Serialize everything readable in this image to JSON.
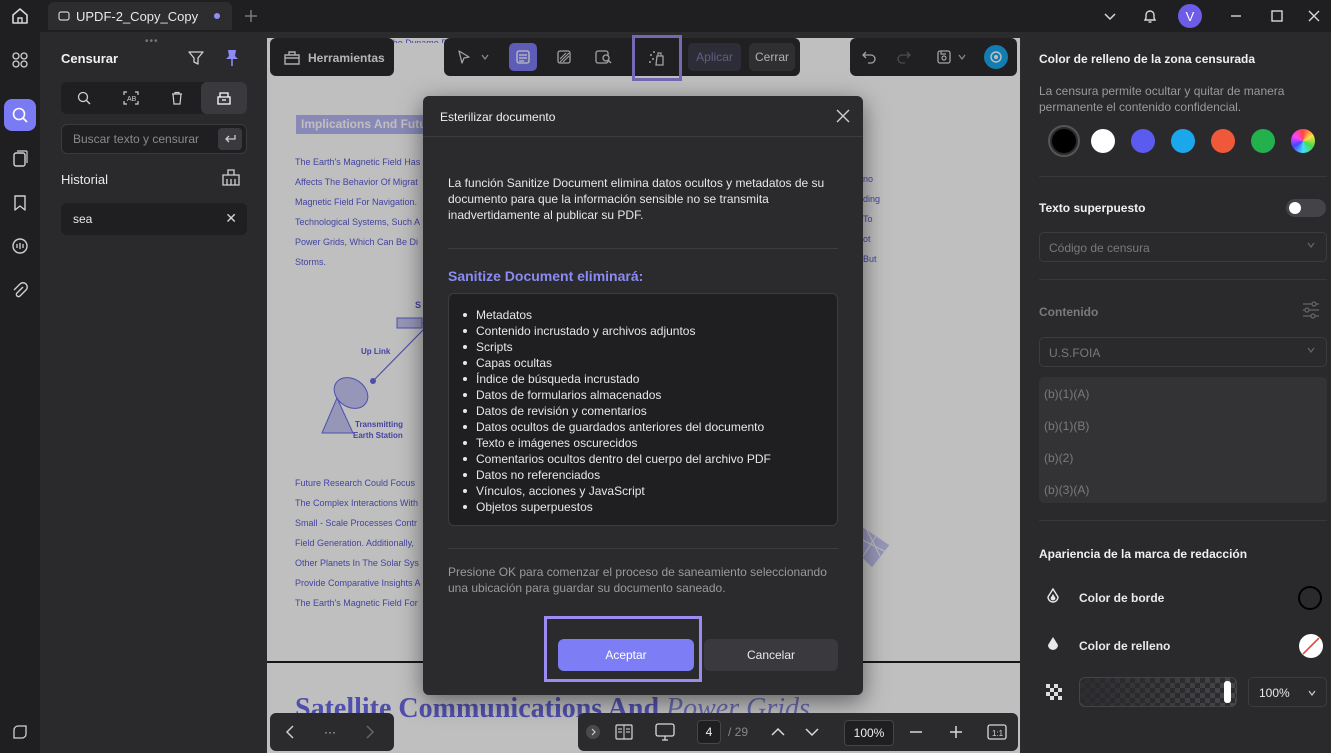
{
  "titlebar": {
    "tab_title": "UPDF-2_Copy_Copy",
    "avatar_letter": "V",
    "accent": "#7d7df6"
  },
  "left_panel": {
    "title": "Censurar",
    "search_placeholder": "Buscar texto y censurar",
    "history_label": "Historial",
    "history_items": [
      "sea"
    ]
  },
  "toolbar": {
    "tools_label": "Herramientas",
    "apply_label": "Aplicar",
    "close_label": "Cerrar"
  },
  "document": {
    "heading": "Implications And Futu",
    "top_cut": "Compared To The Dynamo Process.",
    "lines_left": [
      "The Earth's Magnetic Field Has",
      "Affects The Behavior Of Migrat",
      "Magnetic Field For Navigation.",
      "Technological Systems, Such A",
      "Power Grids, Which Can Be Di",
      "Storms."
    ],
    "lines_right": [
      "no",
      "ding",
      "To",
      "ot",
      "But"
    ],
    "diagram_labels": [
      "S",
      "Up Link",
      "Transmitting",
      "Earth Station"
    ],
    "lines_lower": [
      "Future Research Could Focus",
      "The Complex Interactions With",
      "Small - Scale Processes Contr",
      "Field Generation. Additionally,",
      "Other Planets In The Solar Sys",
      "Provide Comparative Insights A",
      "The Earth's Magnetic Field For"
    ],
    "big_title": "Satellite Communications And",
    "big_title_italic": "Power Grids"
  },
  "dialog": {
    "title": "Esterilizar documento",
    "intro": "La función Sanitize Document elimina datos ocultos y metadatos de su documento para que la información sensible no se transmita inadvertidamente al publicar su PDF.",
    "subtitle": "Sanitize Document eliminará:",
    "items": [
      "Metadatos",
      "Contenido incrustado y archivos adjuntos",
      "Scripts",
      "Capas ocultas",
      "Índice de búsqueda incrustado",
      "Datos de formularios almacenados",
      "Datos de revisión y comentarios",
      "Datos ocultos de guardados anteriores del documento",
      "Texto e imágenes oscurecidos",
      "Comentarios ocultos dentro del cuerpo del archivo PDF",
      "Datos no referenciados",
      "Vínculos, acciones y JavaScript",
      "Objetos superpuestos"
    ],
    "note": "Presione OK para comenzar el proceso de saneamiento seleccionando una ubicación para guardar su documento saneado.",
    "ok_label": "Aceptar",
    "cancel_label": "Cancelar"
  },
  "right_panel": {
    "fill_title": "Color de relleno de la zona censurada",
    "fill_desc": "La censura permite ocultar y quitar de manera permanente el contenido confidencial.",
    "colors": [
      "#000000",
      "#ffffff",
      "#5b5bf0",
      "#1aa7ec",
      "#f0583a",
      "#22b14c"
    ],
    "overlay_label": "Texto superpuesto",
    "code_placeholder": "Código de censura",
    "content_label": "Contenido",
    "content_select": "U.S.FOIA",
    "codes": [
      "(b)(1)(A)",
      "(b)(1)(B)",
      "(b)(2)",
      "(b)(3)(A)"
    ],
    "appearance_title": "Apariencia de la marca de redacción",
    "border_color_label": "Color de borde",
    "fill_color_label": "Color de relleno",
    "opacity": "100%"
  },
  "bottom": {
    "page_current": "4",
    "page_total": "/ 29",
    "zoom": "100%"
  }
}
